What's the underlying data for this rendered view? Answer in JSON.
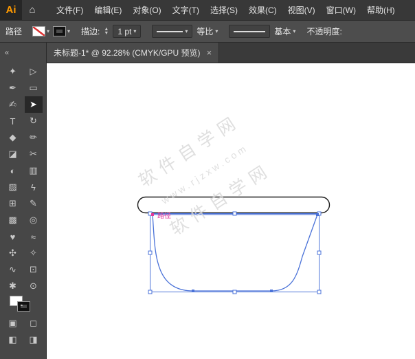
{
  "app": {
    "logo": "Ai"
  },
  "menu_bar": {
    "items": [
      {
        "id": "file",
        "label": "文件(F)"
      },
      {
        "id": "edit",
        "label": "编辑(E)"
      },
      {
        "id": "object",
        "label": "对象(O)"
      },
      {
        "id": "type",
        "label": "文字(T)"
      },
      {
        "id": "select",
        "label": "选择(S)"
      },
      {
        "id": "effect",
        "label": "效果(C)"
      },
      {
        "id": "view",
        "label": "视图(V)"
      },
      {
        "id": "window",
        "label": "窗口(W)"
      },
      {
        "id": "help",
        "label": "帮助(H)"
      }
    ]
  },
  "control_bar": {
    "selection_label": "路径",
    "stroke_label": "描边:",
    "stroke_weight": "1 pt",
    "profile_label": "等比",
    "brush_label": "基本",
    "opacity_label": "不透明度:"
  },
  "tab": {
    "title": "未标题-1* @ 92.28% (CMYK/GPU 预览)",
    "close": "×"
  },
  "toolbar": {
    "collapse": "«",
    "tools": [
      {
        "name": "magic-wand",
        "glyph": "✦"
      },
      {
        "name": "direct-selection",
        "glyph": "▷"
      },
      {
        "name": "pen",
        "glyph": "✒"
      },
      {
        "name": "rectangle",
        "glyph": "▭"
      },
      {
        "name": "paintbrush",
        "glyph": "✍"
      },
      {
        "name": "selection",
        "glyph": "➤",
        "active": true
      },
      {
        "name": "type",
        "glyph": "T"
      },
      {
        "name": "rotate",
        "glyph": "↻"
      },
      {
        "name": "knife",
        "glyph": "◆"
      },
      {
        "name": "pencil",
        "glyph": "✏"
      },
      {
        "name": "eraser",
        "glyph": "◪"
      },
      {
        "name": "scissors",
        "glyph": "✂"
      },
      {
        "name": "gradient",
        "glyph": "◐"
      },
      {
        "name": "column-graph",
        "glyph": "▥"
      },
      {
        "name": "mesh",
        "glyph": "▨"
      },
      {
        "name": "slice",
        "glyph": "ϟ"
      },
      {
        "name": "shaper",
        "glyph": "⊞"
      },
      {
        "name": "curvature",
        "glyph": "✎"
      },
      {
        "name": "perspective-grid",
        "glyph": "▩"
      },
      {
        "name": "symbol-sprayer",
        "glyph": "◎"
      },
      {
        "name": "shape-builder",
        "glyph": "♥"
      },
      {
        "name": "blend",
        "glyph": "≈"
      },
      {
        "name": "width-tool",
        "glyph": "✣"
      },
      {
        "name": "eyedropper",
        "glyph": "✧"
      },
      {
        "name": "smooth",
        "glyph": "∿"
      },
      {
        "name": "artboard",
        "glyph": "⊡"
      },
      {
        "name": "hand",
        "glyph": "✱"
      },
      {
        "name": "zoom",
        "glyph": "⊙"
      }
    ],
    "bottom_tools": [
      {
        "name": "draw-normal-mode",
        "glyph": "▣"
      },
      {
        "name": "draw-behind-mode",
        "glyph": "◻"
      },
      {
        "name": "screen-mode",
        "glyph": "◧"
      },
      {
        "name": "change-screen-mode",
        "glyph": "◨"
      }
    ]
  },
  "canvas": {
    "watermark": {
      "line1": "软件自学网",
      "line2": "www.rjzxw.com",
      "line3": "软件自学网"
    },
    "path_label": "路径"
  },
  "colors": {
    "accent_blue": "#4a72d8",
    "selection_magenta": "#e6399b",
    "logo_amber": "#ff9a00",
    "fill_none_red": "#dd3333",
    "watermark_gray": "#d8d8d8",
    "menubar_bg": "#383838",
    "controlbar_bg": "#4d4d4d",
    "tabbar_bg": "#3a3a3a",
    "tab_active_bg": "#4a4a4a",
    "toolbar_bg": "#474747",
    "tool_active_bg": "#282828",
    "canvas_bg": "#ffffff",
    "field_bg": "#424242",
    "field_border": "#2e2e2e",
    "text_light": "#e8e8e8"
  }
}
